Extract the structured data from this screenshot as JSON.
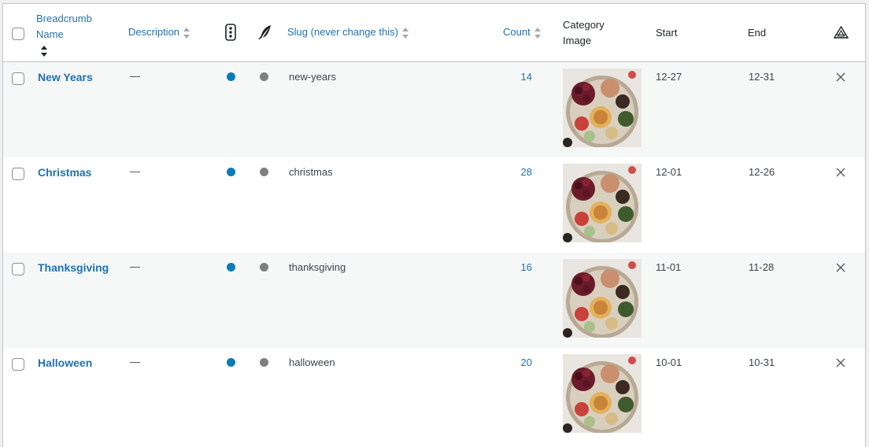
{
  "headers": {
    "name": [
      "Breadcrumb",
      "Name"
    ],
    "description": "Description",
    "status_icon": "traffic-light-icon",
    "feather_icon": "feather-icon",
    "slug": "Slug (never change this)",
    "count": "Count",
    "image": [
      "Category",
      "Image"
    ],
    "start": "Start",
    "end": "End",
    "extra_icon": "triangle-icon"
  },
  "rows": [
    {
      "name": "New Years",
      "description": "—",
      "slug": "new-years",
      "count": "14",
      "start": "12-27",
      "end": "12-31"
    },
    {
      "name": "Christmas",
      "description": "—",
      "slug": "christmas",
      "count": "28",
      "start": "12-01",
      "end": "12-26"
    },
    {
      "name": "Thanksgiving",
      "description": "—",
      "slug": "thanksgiving",
      "count": "16",
      "start": "11-01",
      "end": "11-28"
    },
    {
      "name": "Halloween",
      "description": "—",
      "slug": "halloween",
      "count": "20",
      "start": "10-01",
      "end": "10-31"
    }
  ],
  "colors": {
    "link": "#2271b1",
    "dot_blue": "#0a7ab8",
    "dot_gray": "#7f7f7f"
  }
}
